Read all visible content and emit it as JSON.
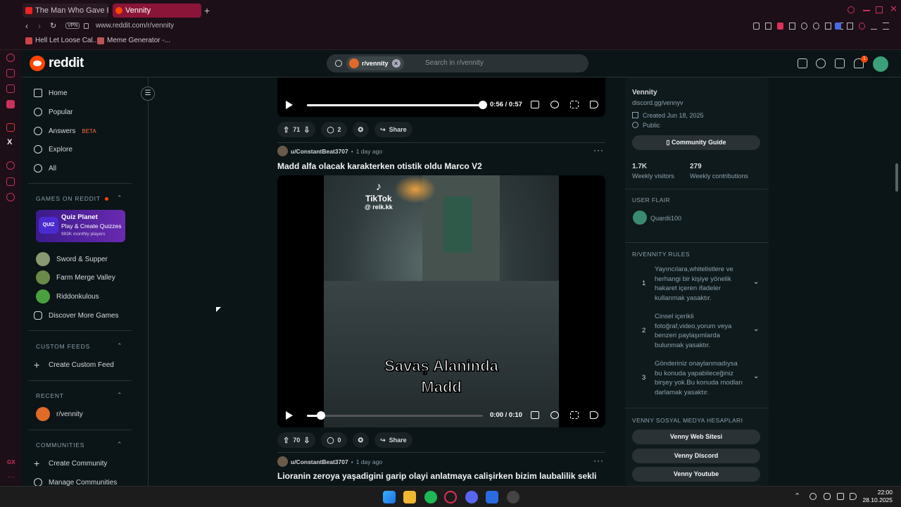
{
  "browser": {
    "tabs": [
      {
        "title": "The Man Who Gave Every",
        "active": false
      },
      {
        "title": "Vennity",
        "active": true
      }
    ],
    "new_tab": "+",
    "address": "www.reddit.com/r/vennity",
    "vpn": "VPN",
    "bookmarks": [
      "Hell Let Loose Cal...",
      "Meme Generator -..."
    ]
  },
  "header": {
    "logo": "reddit",
    "search_chip": "r/vennity",
    "search_placeholder": "Search in r/vennity",
    "notification_count": "1"
  },
  "leftnav": {
    "items": [
      {
        "label": "Home",
        "icon": "home-icon"
      },
      {
        "label": "Popular",
        "icon": "popular-icon"
      },
      {
        "label": "Answers",
        "icon": "answers-icon",
        "badge": "BETA"
      },
      {
        "label": "Explore",
        "icon": "explore-icon"
      },
      {
        "label": "All",
        "icon": "all-icon"
      }
    ],
    "games_header": "GAMES ON REDDIT",
    "featured_game": {
      "title": "Quiz Planet",
      "subtitle": "Play & Create Quizzes",
      "meta": "993K monthly players",
      "logo": "QUIZ"
    },
    "games": [
      "Sword & Supper",
      "Farm Merge Valley",
      "Riddonkulous",
      "Discover More Games"
    ],
    "custom_feeds_header": "CUSTOM FEEDS",
    "create_custom_feed": "Create Custom Feed",
    "recent_header": "RECENT",
    "recent": [
      "r/vennity"
    ],
    "communities_header": "COMMUNITIES",
    "create_community": "Create Community",
    "manage_communities": "Manage Communities"
  },
  "feed": {
    "post1": {
      "time": "0:56 / 0:57",
      "progress": 1.0,
      "upvotes": "71",
      "comments": "2",
      "share": "Share"
    },
    "post2": {
      "author": "u/ConstantBeat3707",
      "age": "1 day ago",
      "title": "Madd alfa olacak karakterken otistik oldu Marco V2",
      "tiktok": "TikTok",
      "tiktok_user": "@ reik.kk",
      "caption": "Savaş Alaninda Madd",
      "time": "0:00 / 0:10",
      "progress": 0.08,
      "upvotes": "70",
      "comments": "0",
      "share": "Share"
    },
    "post3": {
      "author": "u/ConstantBeat3707",
      "age": "1 day ago",
      "title": "Lioranin zeroya yaşadigini garip olayi anlatmaya calişirken bizim laubalilik sekli"
    }
  },
  "sidebar": {
    "name": "Vennity",
    "link": "discord.gg/vennyv",
    "created": "Created Jun 18, 2025",
    "visibility": "Public",
    "guide_button": "Community Guide",
    "weekly_visitors": "1.7K",
    "weekly_visitors_label": "Weekly visitors",
    "weekly_contributions": "279",
    "weekly_contributions_label": "Weekly contributions",
    "user_flair_header": "USER FLAIR",
    "flair_user": "Quardii100",
    "rules_header": "R/VENNITY RULES",
    "rules": [
      {
        "n": "1",
        "text": "Yayıncılara,whitelistlere ve herhangi bir kişiye yönelik hakaret içeren ifadeler kullanmak yasaktır."
      },
      {
        "n": "2",
        "text": "Cinsel içerikli fotoğraf,video,yorum veya benzeri paylaşımlarda bulunmak yasaktır."
      },
      {
        "n": "3",
        "text": "Gönderiniz onaylanmadıysa bu konuda yapabileceğiniz birşey yok.Bu konuda modları darlamak yasaktır."
      }
    ],
    "social_header": "VENNY SOSYAL MEDYA HESAPLARI",
    "social_buttons": [
      "Venny Web Sitesi",
      "Venny Discord",
      "Venny Youtube"
    ]
  },
  "taskbar": {
    "time": "22:00",
    "date": "28.10.2025"
  }
}
